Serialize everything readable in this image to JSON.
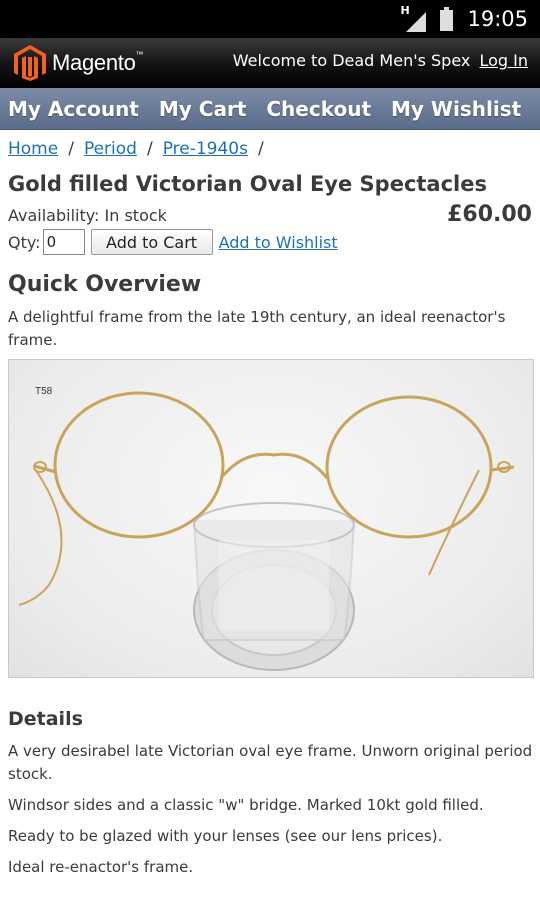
{
  "status_bar": {
    "network_badge": "H",
    "time": "19:05",
    "icons": [
      "signal-icon",
      "battery-icon"
    ]
  },
  "header": {
    "logo_text": "Magento",
    "logo_mark": "™",
    "welcome_text": "Welcome to Dead Men's Spex",
    "login_label": "Log In"
  },
  "nav": {
    "items": [
      {
        "label": "My Account"
      },
      {
        "label": "My Cart"
      },
      {
        "label": "Checkout"
      },
      {
        "label": "My Wishlist"
      }
    ]
  },
  "breadcrumb": {
    "items": [
      "Home",
      "Period",
      "Pre-1940s"
    ],
    "separator": "/"
  },
  "product": {
    "title": "Gold filled Victorian Oval Eye Spectacles",
    "availability": "Availability: In stock",
    "price": "£60.00",
    "qty_label": "Qty:",
    "qty_value": "0",
    "add_to_cart_label": "Add to Cart",
    "add_to_wishlist_label": "Add to Wishlist"
  },
  "overview": {
    "title": "Quick Overview",
    "text": "A delightful frame from the late 19th century, an ideal reenactor's frame."
  },
  "image": {
    "label": "T58"
  },
  "details": {
    "title": "Details",
    "paragraphs": [
      "A very desirabel late Victorian oval eye frame. Unworn original period stock.",
      "Windsor sides and a classic \"w\" bridge. Marked 10kt gold filled.",
      "Ready to be glazed with your lenses (see our lens prices).",
      "Ideal re-enactor's frame."
    ]
  },
  "colors": {
    "link": "#1e70b4",
    "nav_bar": "#6a7b99",
    "header": "#000000",
    "text": "#3b3b3b",
    "logo_orange": "#f26322"
  }
}
